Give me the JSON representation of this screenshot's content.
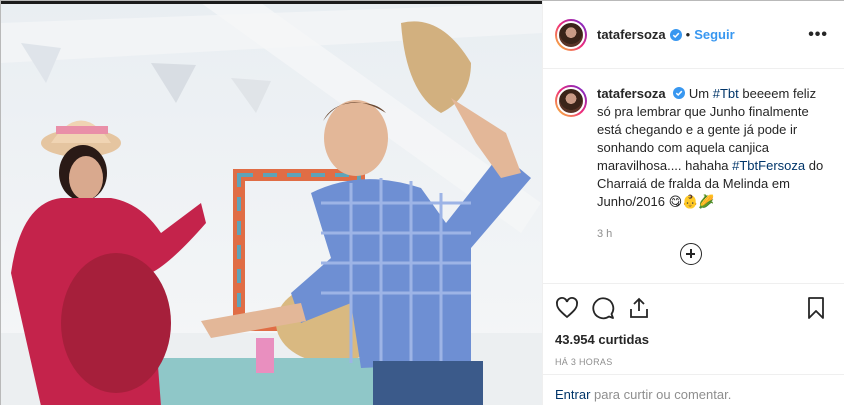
{
  "post": {
    "username": "tatafersoza",
    "follow_label": "Seguir",
    "more_label": "•••",
    "dot": "•",
    "caption": {
      "part1": "Um ",
      "tag1": "#Tbt",
      "part2": " beeeem feliz só pra lembrar que Junho finalmente está chegando e a gente já pode ir sonhando com aquela canjica maravilhosa.... hahaha ",
      "tag2": "#TbtFersoza",
      "part3": " do Charraiá de fralda da Melinda em Junho/2016 😋👶🌽"
    },
    "time_ago": "3 h",
    "likes": "43.954 curtidas",
    "date": "HÁ 3 HORAS",
    "add_comment": {
      "link": "Entrar",
      "text": " para curtir ou comentar."
    }
  },
  "icons": [
    "verified-badge-icon",
    "heart-icon",
    "comment-icon",
    "share-icon",
    "bookmark-icon",
    "load-more-plus-icon"
  ],
  "colors": {
    "link": "#3897f0",
    "hashtag": "#003569",
    "muted": "#8e8e8e"
  }
}
